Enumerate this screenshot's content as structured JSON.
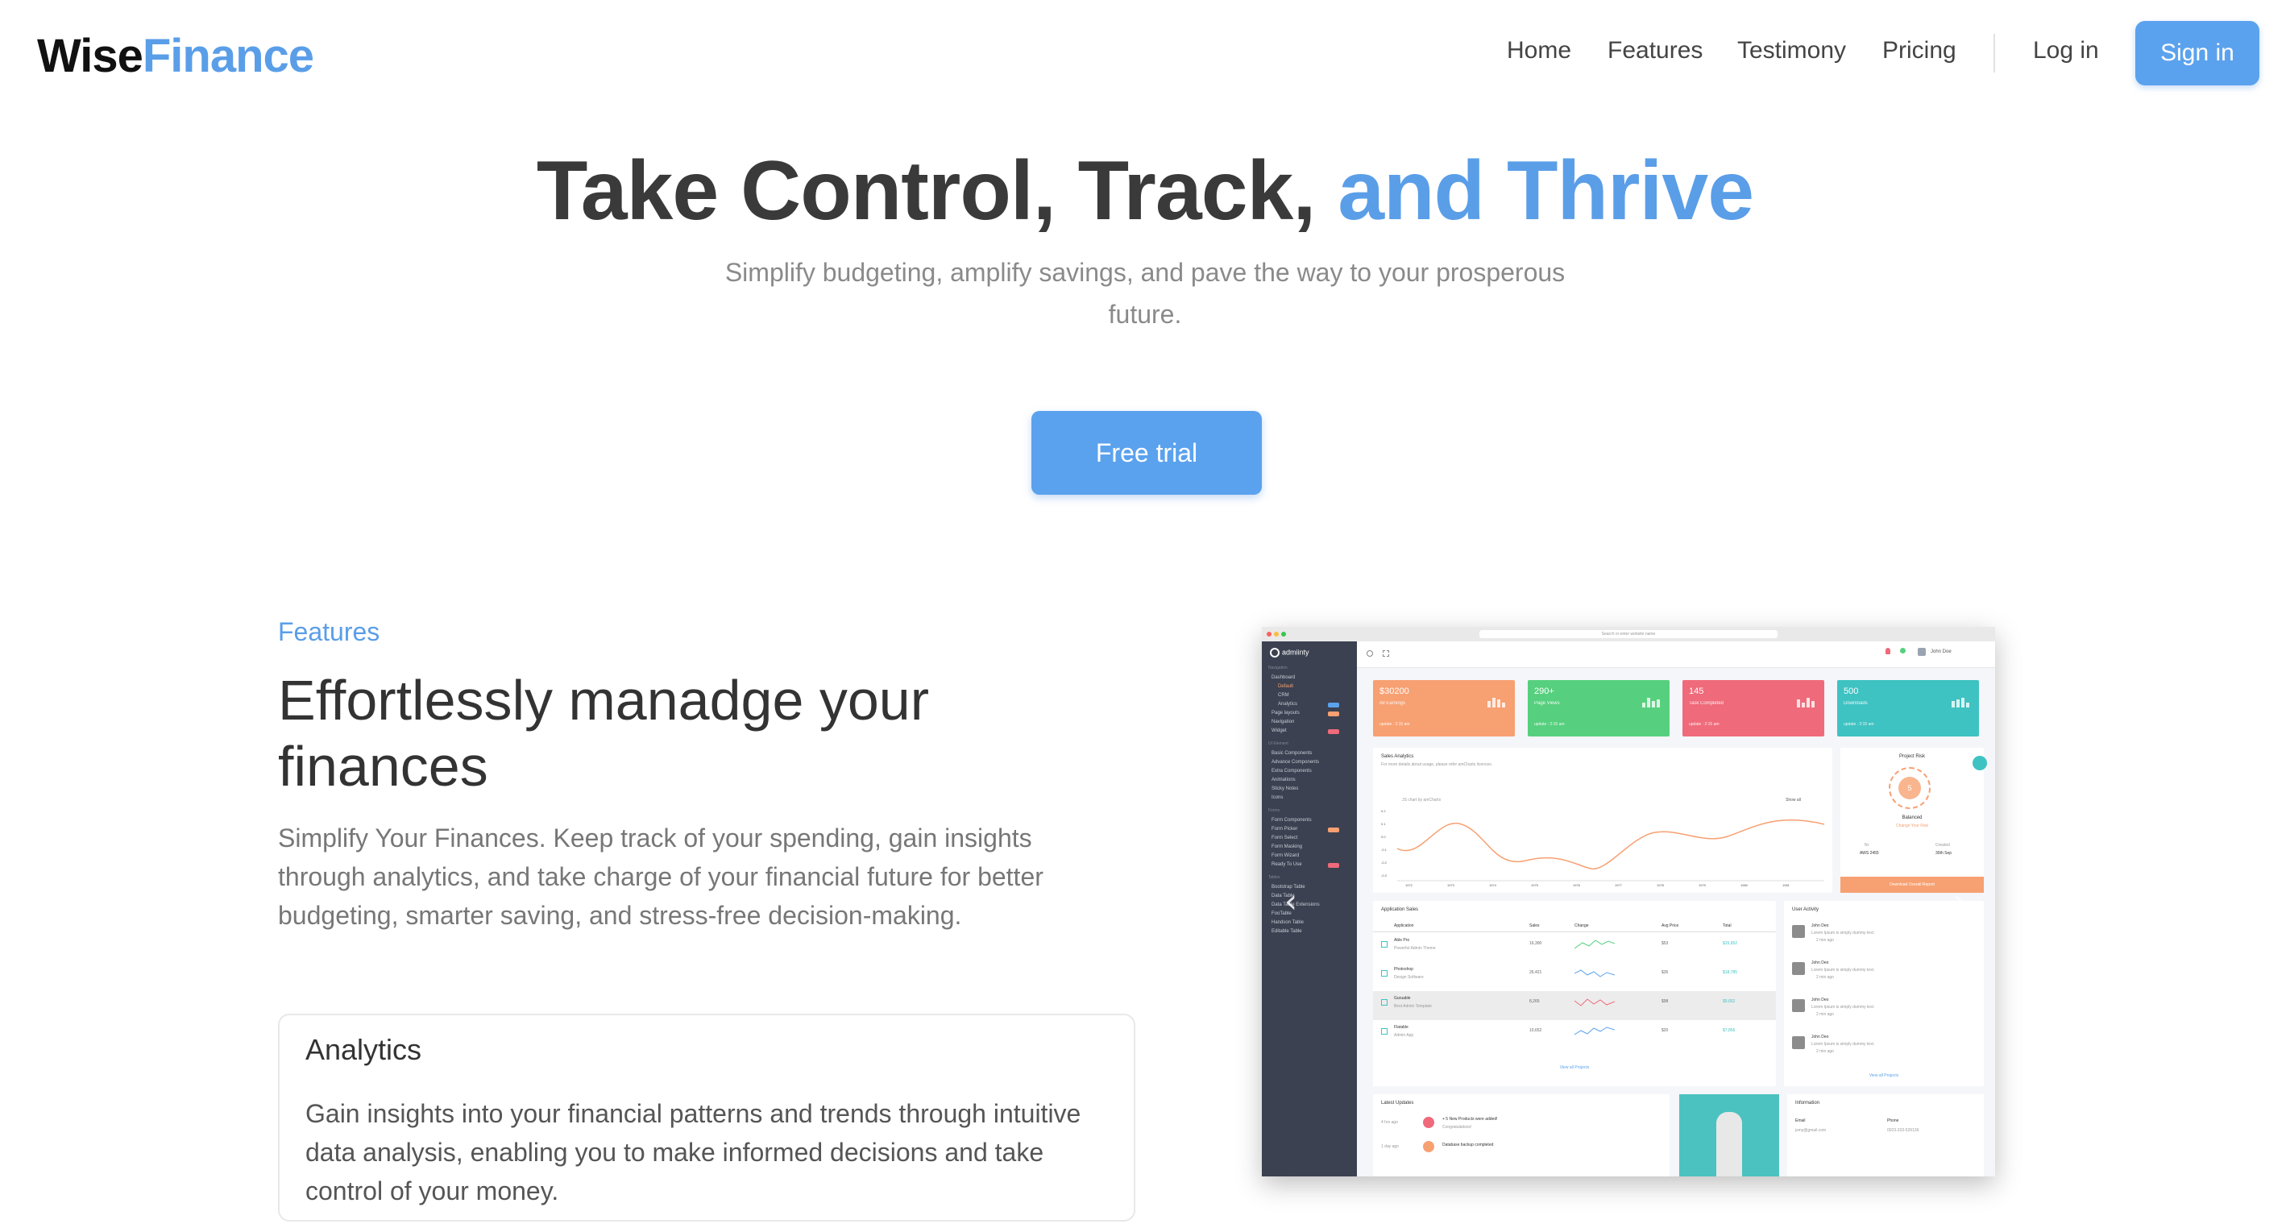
{
  "header": {
    "logo_part1": "Wise",
    "logo_part2": "Finance",
    "nav": [
      "Home",
      "Features",
      "Testimony",
      "Pricing"
    ],
    "login": "Log in",
    "signin": "Sign in"
  },
  "hero": {
    "title_main": "Take Control, Track, ",
    "title_accent": "and Thrive",
    "subtitle": "Simplify budgeting, amplify savings, and pave the way to your prosperous future.",
    "cta": "Free trial"
  },
  "features": {
    "label": "Features",
    "title": "Effortlessly manadge your finances",
    "description": "Simplify Your Finances. Keep track of your spending, gain insights through analytics, and take charge of your financial future for better budgeting, smarter saving, and stress-free decision-making.",
    "card": {
      "title": "Analytics",
      "description": "Gain insights into your financial patterns and trends through intuitive data analysis, enabling you to make informed decisions and take control of your money."
    }
  },
  "dashboard": {
    "brand": "admiinty",
    "url": "Search or enter website name",
    "user": "John Doe",
    "sidebar": {
      "heading_nav": "Navigation",
      "items_nav": [
        "Dashboard",
        "Default",
        "CRM",
        "Analytics",
        "Page layouts",
        "Navigation",
        "Widget"
      ],
      "heading_ui": "UI Element",
      "items_ui": [
        "Basic Components",
        "Advance Components",
        "Extra Components",
        "Animations",
        "Sticky Notes",
        "Icons"
      ],
      "heading_forms": "Forms",
      "items_forms": [
        "Form Components",
        "Form Picker",
        "Form Select",
        "Form Masking",
        "Form Wizard",
        "Ready To Use"
      ],
      "heading_tables": "Tables",
      "items_tables": [
        "Bootstrap Table",
        "Data Table",
        "Data Table Extensions",
        "FooTable",
        "Handson Table",
        "Editable Table"
      ]
    },
    "stats": [
      {
        "value": "$30200",
        "label": "All Earnings",
        "update": "update : 2:15 am",
        "color": "#f7a072"
      },
      {
        "value": "290+",
        "label": "Page Views",
        "update": "update : 2:15 am",
        "color": "#56d07e"
      },
      {
        "value": "145",
        "label": "Task Completed",
        "update": "update : 2:15 am",
        "color": "#ef6a7a"
      },
      {
        "value": "500",
        "label": "Downloads",
        "update": "update : 2:15 am",
        "color": "#3fc2c2"
      }
    ],
    "sales_analytics": {
      "title": "Sales Analytics",
      "subtitle": "For more details about usage, please refer amCharts licences.",
      "chart_hint": "JS chart by amCharts",
      "show_all": "Show all",
      "years": [
        "1972",
        "1973",
        "1974",
        "1975",
        "1976",
        "1977",
        "1978",
        "1979",
        "1980",
        "1981"
      ],
      "y_ticks": [
        "0.2",
        "0.1",
        "0.0",
        "-0.1",
        "-0.2",
        "-0.3"
      ]
    },
    "project_risk": {
      "title": "Project Risk",
      "gauge_value": "5",
      "status": "Balanced",
      "change": "Change Your Risk",
      "nr_label": "Nr",
      "nr_value": "AWS 2455",
      "created_label": "Created",
      "created_value": "30th Sep",
      "button": "Download Overall Report"
    },
    "application_sales": {
      "title": "Application Sales",
      "headers": [
        "Application",
        "Sales",
        "Change",
        "Avg Price",
        "Total"
      ],
      "rows": [
        {
          "name": "Able Pro",
          "desc": "Powerful Admin Theme",
          "sales": "16,300",
          "price": "$53",
          "total": "$15,652"
        },
        {
          "name": "Photoshop",
          "desc": "Design Software",
          "sales": "26,421",
          "price": "$35",
          "total": "$18,785"
        },
        {
          "name": "Guruable",
          "desc": "Best Admin Template",
          "sales": "8,265",
          "price": "$98",
          "total": "$9,652"
        },
        {
          "name": "Flatable",
          "desc": "Admin App",
          "sales": "10,652",
          "price": "$20",
          "total": "$7,856"
        }
      ],
      "link": "View all Projects"
    },
    "user_activity": {
      "title": "User Activity",
      "items": [
        {
          "name": "John Deo",
          "text": "Lorem Ipsum is simply dummy text.",
          "time": "2 min ago"
        },
        {
          "name": "John Deo",
          "text": "Lorem Ipsum is simply dummy text.",
          "time": "2 min ago"
        },
        {
          "name": "John Deo",
          "text": "Lorem Ipsum is simply dummy text.",
          "time": "2 min ago"
        },
        {
          "name": "John Deo",
          "text": "Lorem Ipsum is simply dummy text.",
          "time": "2 min ago"
        }
      ],
      "link": "View all Projects"
    },
    "latest_updates": {
      "title": "Latest Updates",
      "items": [
        {
          "time": "4 hrs ago",
          "title": "+ 5 New Products were added!",
          "sub": "Congratulations!"
        },
        {
          "time": "1 day ago",
          "title": "Database backup completed",
          "sub": ""
        }
      ]
    },
    "information": {
      "title": "Information",
      "email_label": "Email",
      "email_value": "jsmy@gmail.com",
      "phone_label": "Phone",
      "phone_value": "0023-333-526136"
    },
    "colors": {
      "accent": "#5ba2ee",
      "sidebar": "#3b4150",
      "chart_line": "#f7a072"
    }
  }
}
